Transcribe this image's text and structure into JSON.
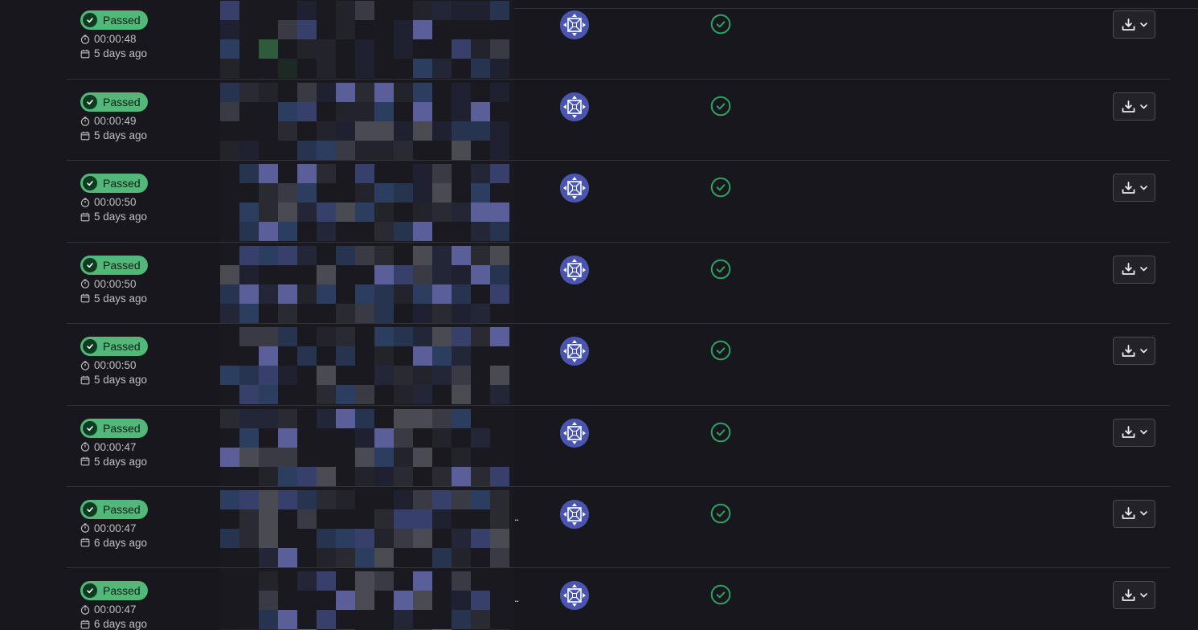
{
  "jobs": [
    {
      "status": "Passed",
      "duration": "00:00:48",
      "finished": "5 days ago",
      "truncated": false
    },
    {
      "status": "Passed",
      "duration": "00:00:49",
      "finished": "5 days ago",
      "truncated": false
    },
    {
      "status": "Passed",
      "duration": "00:00:50",
      "finished": "5 days ago",
      "truncated": false
    },
    {
      "status": "Passed",
      "duration": "00:00:50",
      "finished": "5 days ago",
      "truncated": false
    },
    {
      "status": "Passed",
      "duration": "00:00:50",
      "finished": "5 days ago",
      "truncated": false
    },
    {
      "status": "Passed",
      "duration": "00:00:47",
      "finished": "5 days ago",
      "truncated": false
    },
    {
      "status": "Passed",
      "duration": "00:00:47",
      "finished": "6 days ago",
      "truncated": true
    },
    {
      "status": "Passed",
      "duration": "00:00:47",
      "finished": "6 days ago",
      "truncated": true
    }
  ],
  "ellipsis": "..",
  "icons": {
    "status": "check-circle-icon",
    "duration": "timer-icon",
    "date": "calendar-icon",
    "stage": "check-circle-outline-icon",
    "download": "download-icon",
    "dropdown": "chevron-down-icon"
  },
  "colors": {
    "background": "#18171d",
    "success_badge": "#52b87a",
    "success_icon": "#2da160",
    "avatar": "#4a55b0",
    "divider": "#333238"
  }
}
